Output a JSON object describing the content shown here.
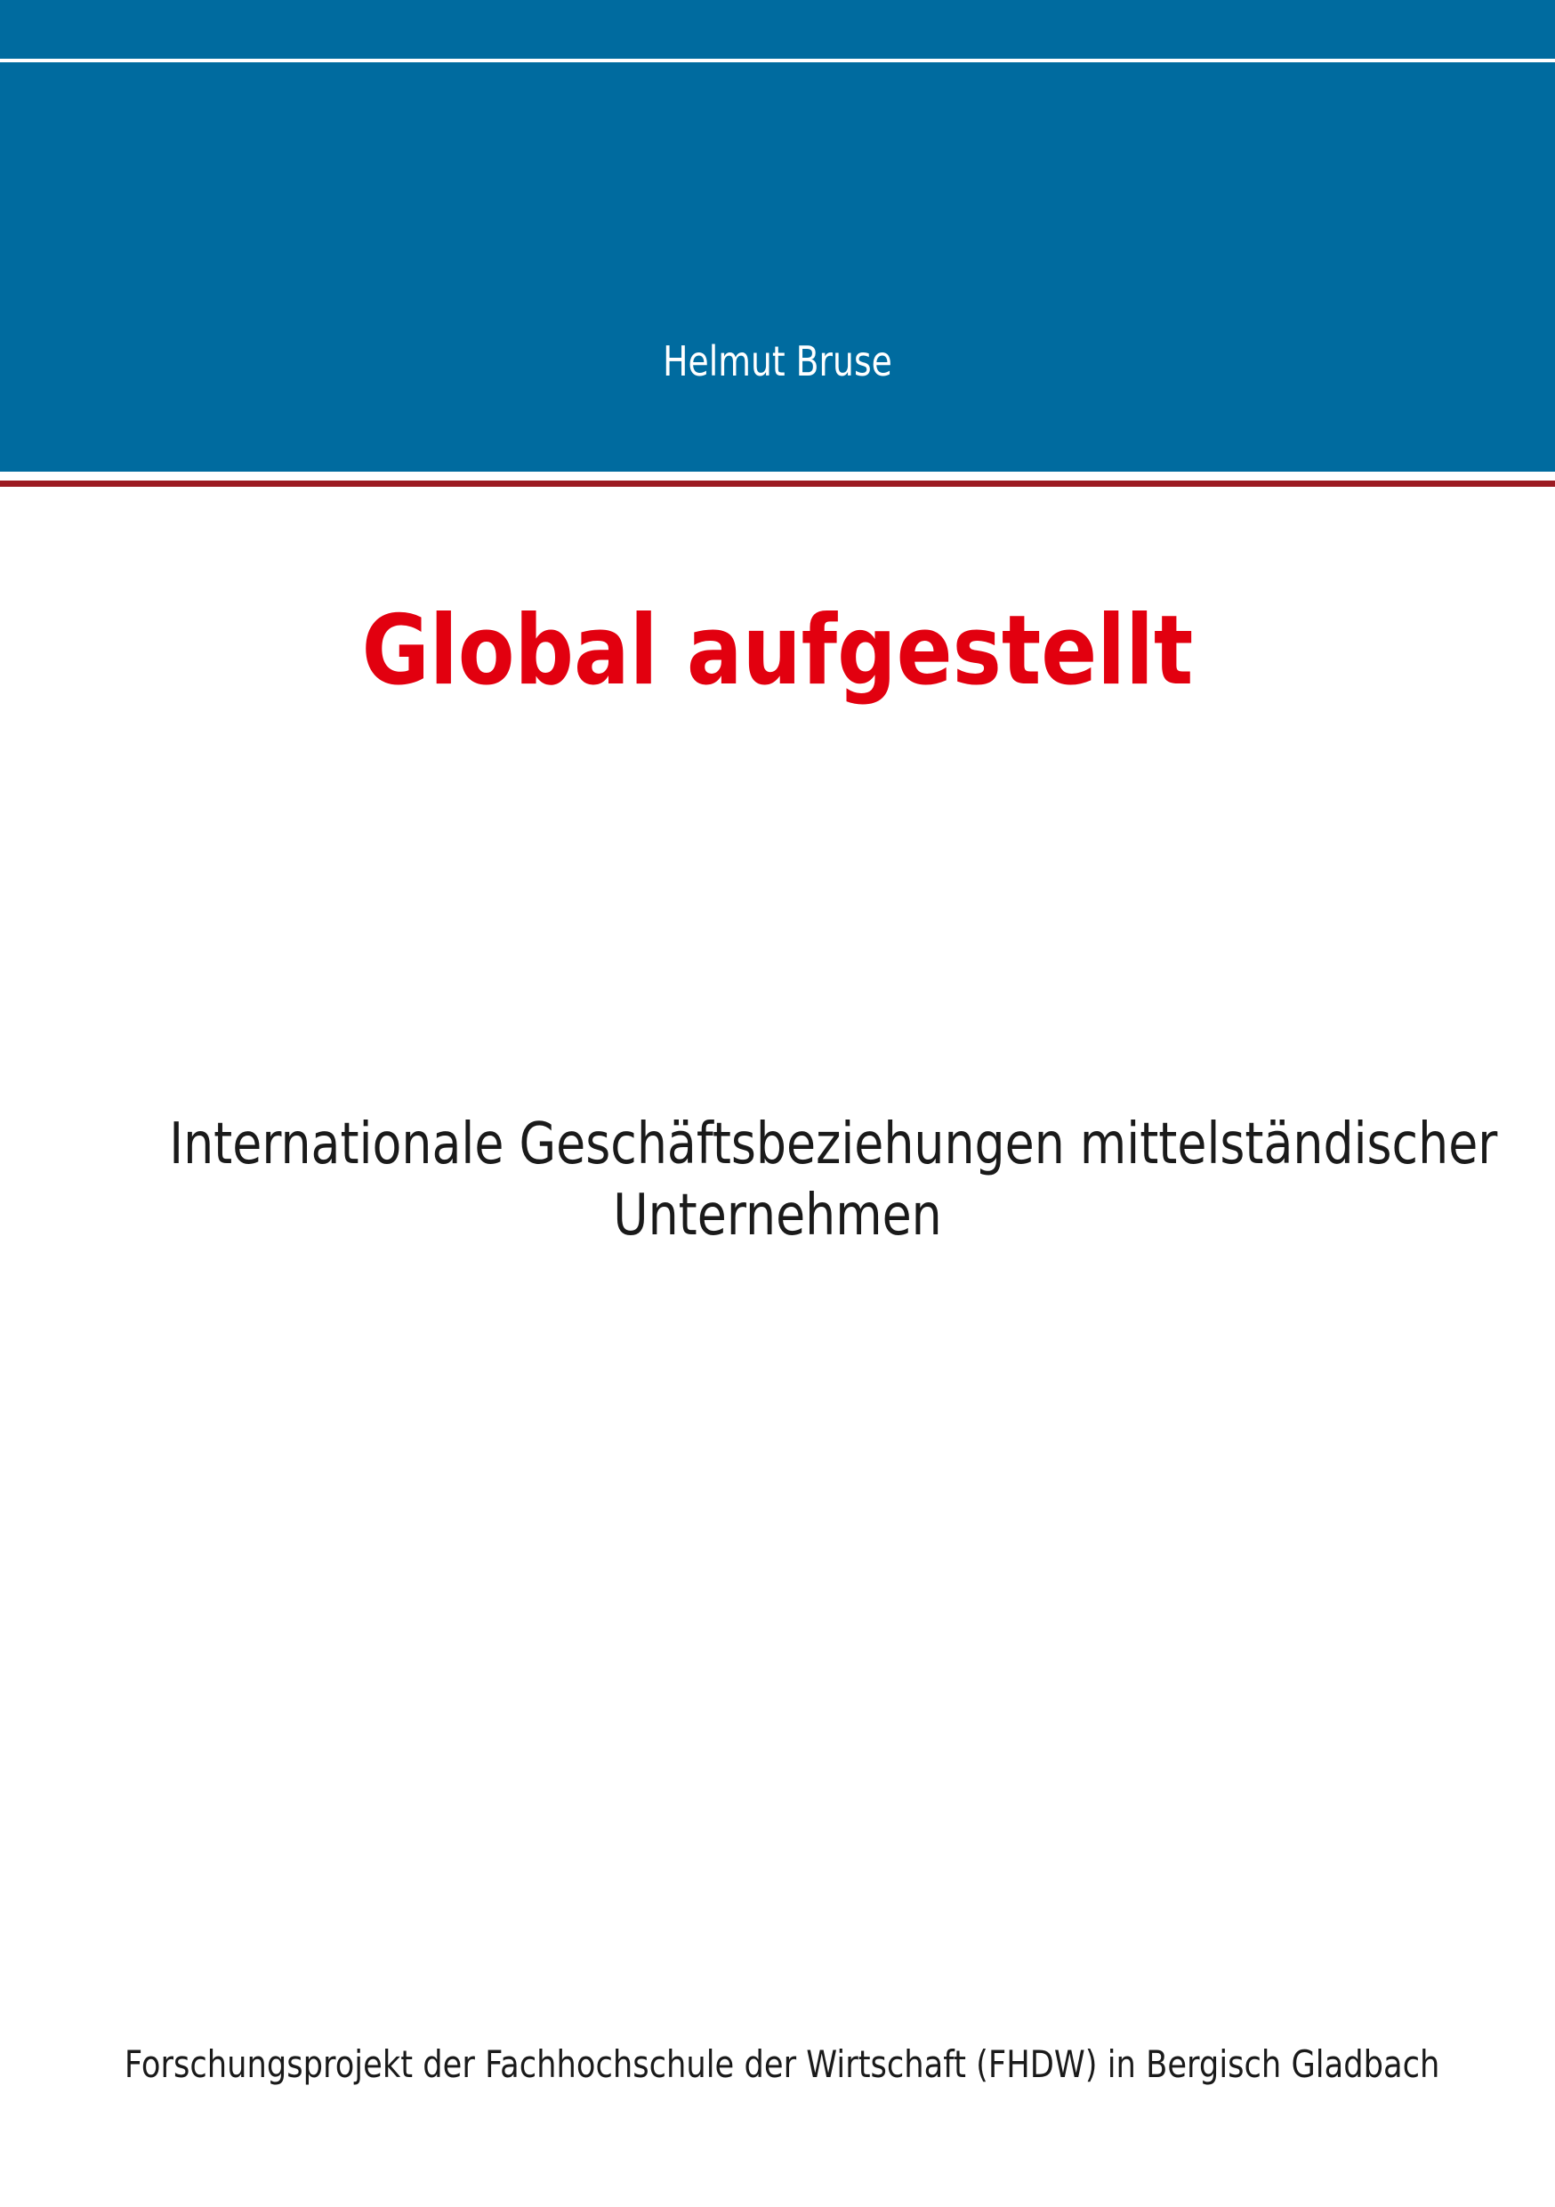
{
  "header": {
    "author": "Helmut Bruse"
  },
  "main": {
    "title": "Global aufgestellt",
    "subtitle_line1": "Internationale Geschäftsbeziehungen mittelständischer",
    "subtitle_line2": "Unternehmen"
  },
  "footer": {
    "text": "Forschungsprojekt der Fachhochschule der Wirtschaft (FHDW) in Bergisch Gladbach"
  },
  "colors": {
    "band": "#006b9f",
    "band_line": "#ffffff",
    "accent_line": "#9c1b22",
    "title": "#e2000f",
    "text": "#1a1a1a",
    "author": "#ffffff"
  }
}
